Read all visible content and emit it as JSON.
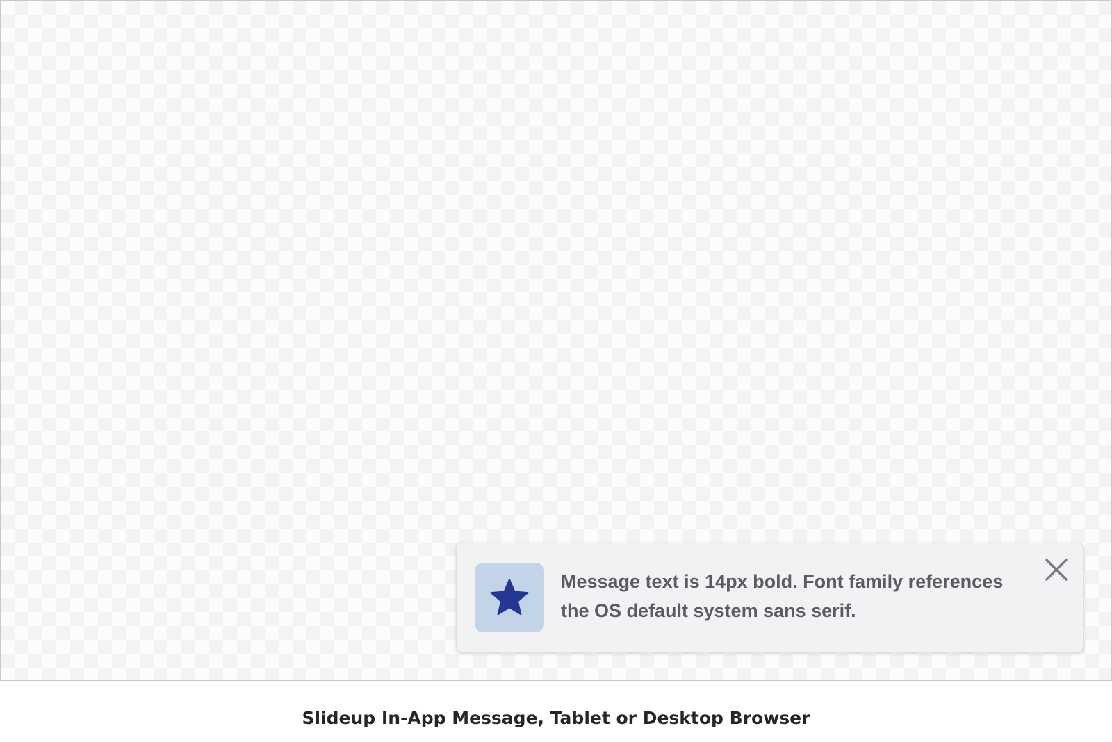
{
  "slideup": {
    "icon": "star-icon",
    "message": "Message text is 14px bold. Font family references the OS default system sans serif.",
    "close_icon": "close-icon"
  },
  "caption": "Slideup In-App Message, Tablet or Desktop Browser",
  "colors": {
    "icon_background": "#c4d4e8",
    "icon_star": "#263793",
    "message_text": "#5b5b61",
    "slideup_background": "#f2f2f4",
    "close_icon": "#7b7b80"
  }
}
